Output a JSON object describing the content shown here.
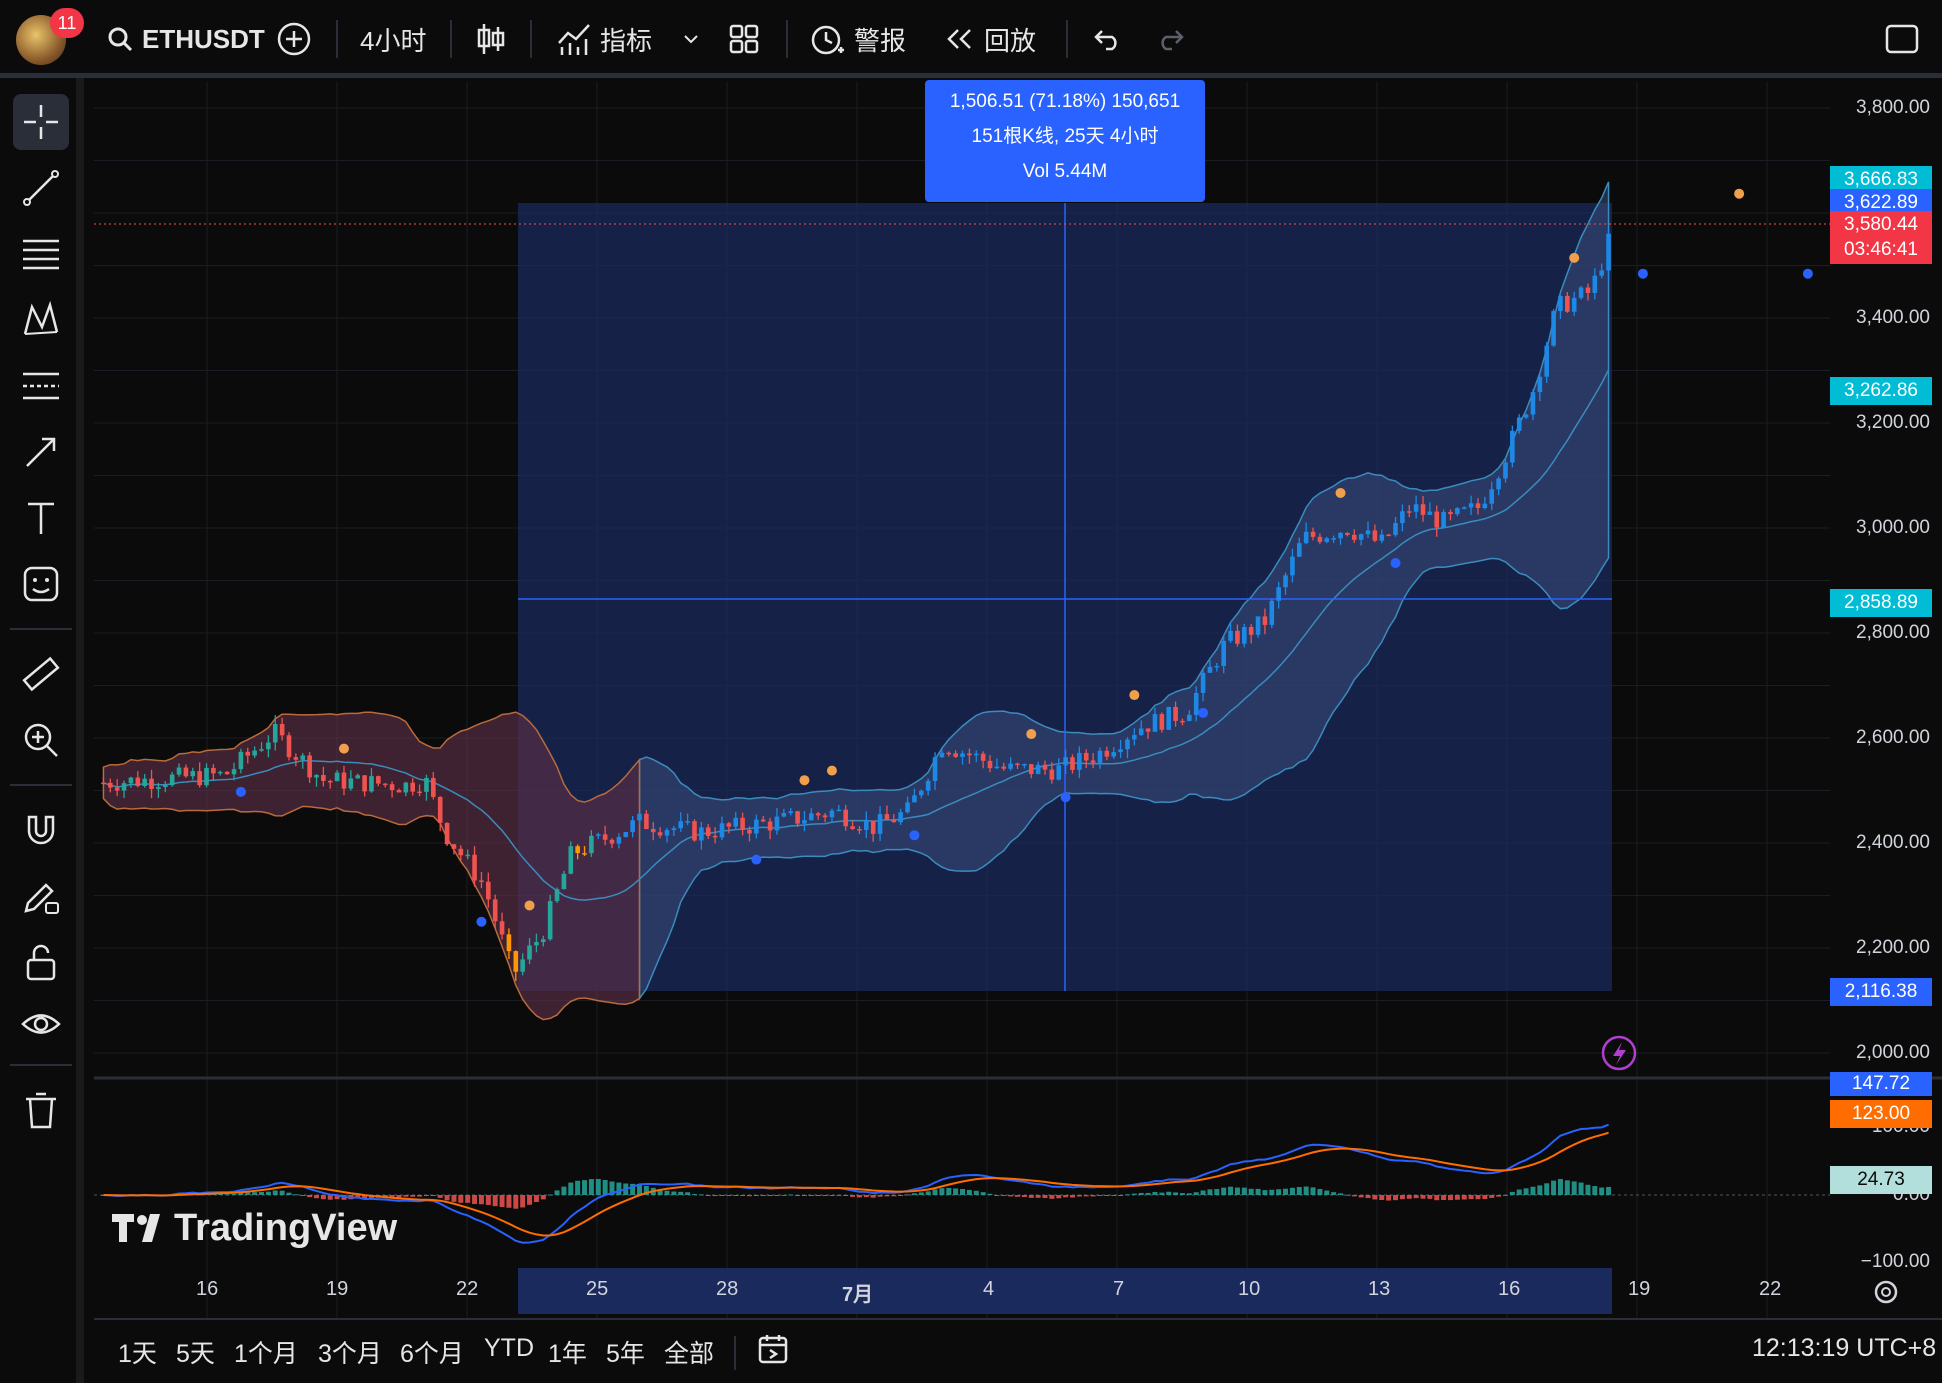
{
  "topbar": {
    "badge_count": "11",
    "symbol": "ETHUSDT",
    "interval": "4小时",
    "indicators_label": "指标",
    "alert_label": "警报",
    "replay_label": "回放"
  },
  "price_axis": {
    "labels": [
      "3,800.00",
      "3,400.00",
      "3,200.00",
      "3,000.00",
      "2,800.00",
      "2,600.00",
      "2,400.00",
      "2,200.00",
      "2,000.00"
    ],
    "tags": {
      "tag_a": "3,666.83",
      "tag_b": "3,622.89",
      "current_price": "3,580.44",
      "countdown": "03:46:41",
      "tag_c": "3,262.86",
      "tag_d": "2,858.89",
      "tag_e": "2,116.38"
    }
  },
  "macd_axis": {
    "labels": [
      "100.00",
      "0.00",
      "−100.00"
    ],
    "tags": {
      "macd": "147.72",
      "signal": "123.00",
      "hist": "24.73"
    }
  },
  "time_axis": [
    "16",
    "19",
    "22",
    "25",
    "28",
    "7月",
    "4",
    "7",
    "10",
    "13",
    "16",
    "19",
    "22"
  ],
  "measure_tooltip": {
    "line1": "1,506.51 (71.18%) 150,651",
    "line2": "151根K线, 25天 4小时",
    "line3": "Vol 5.44M"
  },
  "watermark": "TradingView",
  "bottombar": {
    "ranges": [
      "1天",
      "5天",
      "1个月",
      "3个月",
      "6个月",
      "YTD",
      "1年",
      "5年",
      "全部"
    ],
    "clock": "12:13:19 UTC+8"
  },
  "colors": {
    "up": "#26a69a",
    "down": "#ef5350",
    "accent": "#2962ff",
    "measure_fill": "#1b2a5c"
  }
}
